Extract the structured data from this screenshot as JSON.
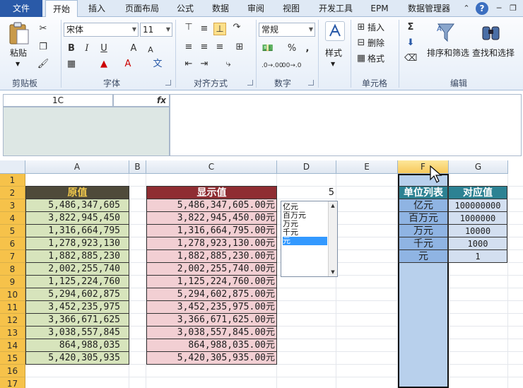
{
  "tabs": {
    "file": "文件",
    "items": [
      "开始",
      "插入",
      "页面布局",
      "公式",
      "数据",
      "审阅",
      "视图",
      "开发工具",
      "EPM",
      "数据管理器"
    ],
    "active": "开始"
  },
  "window": {
    "help": "?"
  },
  "ribbon": {
    "clipboard": {
      "label": "剪贴板",
      "paste": "粘贴"
    },
    "font": {
      "label": "字体",
      "name": "宋体",
      "size": "11",
      "bold": "B",
      "italic": "I",
      "underline": "U",
      "grow": "A",
      "shrink": "A",
      "wen": "文"
    },
    "alignment": {
      "label": "对齐方式"
    },
    "number": {
      "label": "数字",
      "format": "常规",
      "percent": "%",
      "comma": ",",
      "inc": ".0→.00",
      "dec": ".00→.0"
    },
    "styles": {
      "label": "样式"
    },
    "cells": {
      "label": "单元格",
      "insert": "插入",
      "delete": "删除",
      "format": "格式"
    },
    "editing": {
      "label": "编辑",
      "sort_filter": "排序和筛选",
      "find_select": "查找和选择",
      "sigma": "Σ"
    }
  },
  "formula_bar": {
    "name_box": "1C",
    "fx": "fx",
    "value": ""
  },
  "columns": [
    "A",
    "B",
    "C",
    "D",
    "E",
    "F",
    "G"
  ],
  "rows": [
    "1",
    "2",
    "3",
    "4",
    "5",
    "6",
    "7",
    "8",
    "9",
    "10",
    "11",
    "12",
    "13",
    "14",
    "15",
    "16",
    "17"
  ],
  "sheet": {
    "header_a": "原值",
    "header_c": "显示值",
    "header_f": "单位列表",
    "header_g": "对应值",
    "d2": "5",
    "col_a": [
      "5,486,347,605",
      "3,822,945,450",
      "1,316,664,795",
      "1,278,923,130",
      "1,882,885,230",
      "2,002,255,740",
      "1,125,224,760",
      "5,294,602,875",
      "3,452,235,975",
      "3,366,671,625",
      "3,038,557,845",
      "864,988,035",
      "5,420,305,935"
    ],
    "col_c": [
      "5,486,347,605.00元",
      "3,822,945,450.00元",
      "1,316,664,795.00元",
      "1,278,923,130.00元",
      "1,882,885,230.00元",
      "2,002,255,740.00元",
      "1,125,224,760.00元",
      "5,294,602,875.00元",
      "3,452,235,975.00元",
      "3,366,671,625.00元",
      "3,038,557,845.00元",
      "864,988,035.00元",
      "5,420,305,935.00元"
    ],
    "col_f": [
      "亿元",
      "百万元",
      "万元",
      "千元",
      "元"
    ],
    "col_g": [
      "100000000",
      "1000000",
      "10000",
      "1000",
      "1"
    ]
  },
  "listbox": {
    "items": [
      "亿元",
      "百万元",
      "万元",
      "千元",
      "元"
    ],
    "selected_index": 4
  }
}
